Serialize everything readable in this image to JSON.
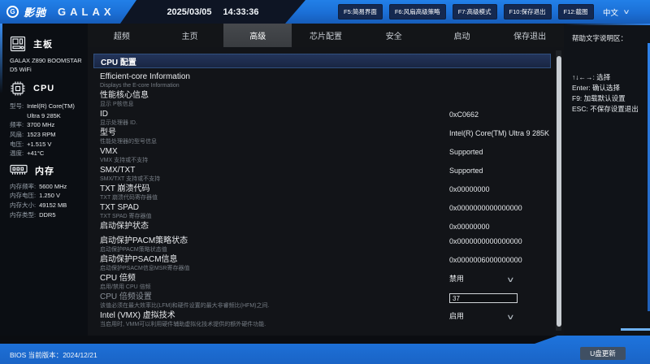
{
  "top_bar": {
    "brand_cn": "影驰",
    "brand_en": "GALAX",
    "logo_glyph": "G",
    "date": "2025/03/05",
    "time": "14:33:36",
    "fkeys": [
      "F5:简易界面",
      "F6:风扇高级策略",
      "F7:高级模式",
      "F10:保存退出",
      "F12:截图"
    ],
    "language": "中文"
  },
  "tabs": [
    {
      "id": "overclock",
      "label": "超频",
      "active": false
    },
    {
      "id": "home",
      "label": "主页",
      "active": false
    },
    {
      "id": "advanced",
      "label": "高级",
      "active": true
    },
    {
      "id": "chipset",
      "label": "芯片配置",
      "active": false
    },
    {
      "id": "security",
      "label": "安全",
      "active": false
    },
    {
      "id": "boot",
      "label": "启动",
      "active": false
    },
    {
      "id": "save-exit",
      "label": "保存退出",
      "active": false
    }
  ],
  "sidebar": {
    "board": {
      "icon": "motherboard-icon",
      "label": "主板",
      "name": "GALAX Z890 BOOMSTAR D5 WiFi"
    },
    "cpu": {
      "icon": "cpu-icon",
      "label": "CPU",
      "rows": [
        {
          "k": "型号:",
          "v": "Intel(R) Core(TM) Ultra 9 285K"
        },
        {
          "k": "频率:",
          "v": "3700 MHz"
        },
        {
          "k": "风扇:",
          "v": "1523 RPM"
        },
        {
          "k": "电压:",
          "v": "+1.515 V"
        },
        {
          "k": "温度:",
          "v": "+41°C"
        }
      ]
    },
    "memory": {
      "icon": "ram-icon",
      "label": "内存",
      "rows": [
        {
          "k": "内存频率:",
          "v": "5600 MHz"
        },
        {
          "k": "内存电压:",
          "v": "1.250 V"
        },
        {
          "k": "内存大小:",
          "v": "49152 MB"
        },
        {
          "k": "内存类型:",
          "v": "DDR5"
        }
      ]
    }
  },
  "content": {
    "section_title": "CPU 配置",
    "rows": [
      {
        "title": "Efficient-core Information",
        "desc": "Displays the E-core Information",
        "value": "",
        "control": "none"
      },
      {
        "title": "性能核心信息",
        "desc": "显示 P核信息",
        "value": "",
        "control": "none"
      },
      {
        "title": "ID",
        "desc": "显示处理器 ID.",
        "value": "0xC0662",
        "control": "text"
      },
      {
        "title": "型号",
        "desc": "性能处理器的型号信息",
        "value": "Intel(R) Core(TM) Ultra 9 285K",
        "control": "text"
      },
      {
        "title": "VMX",
        "desc": "VMX 支持或不支持",
        "value": "Supported",
        "control": "text"
      },
      {
        "title": "SMX/TXT",
        "desc": "SMX/TXT 支持或不支持",
        "value": "Supported",
        "control": "text"
      },
      {
        "title": "TXT 崩溃代码",
        "desc": "TXT 崩溃代码寄存器值",
        "value": "0x00000000",
        "control": "text"
      },
      {
        "title": "TXT SPAD",
        "desc": "TXT SPAD 寄存器值",
        "value": "0x0000000000000000",
        "control": "text"
      },
      {
        "title": "启动保护状态",
        "desc": "",
        "value": "0x00000000",
        "control": "text",
        "short": true
      },
      {
        "title": "启动保护PACM策略状态",
        "desc": "启动保护PACM策略状态值",
        "value": "0x0000000000000000",
        "control": "text"
      },
      {
        "title": "启动保护PSACM信息",
        "desc": "启动保护PSACM信息MSR寄存器值",
        "value": "0x0000006000000000",
        "control": "text"
      },
      {
        "title": "CPU 倍频",
        "desc": "启用/禁用 CPU 倍频",
        "value": "禁用",
        "control": "select"
      },
      {
        "title": "CPU 倍频设置",
        "desc": "该值必须在最大效率比(LFM)和硬件设置的最大非睿频比(HFM)之间.",
        "value": "37",
        "control": "input",
        "disabled": true
      },
      {
        "title": "Intel (VMX) 虚拟技术",
        "desc": "当启用时, VMM可以利用硬件辅助虚拟化技术提供的额外硬件功能.",
        "value": "启用",
        "control": "select"
      }
    ]
  },
  "help": {
    "title": "帮助文字说明区：",
    "lines": [
      "↑↓←→:  选择",
      "Enter:  确认选择",
      "F9:  加载默认设置",
      "ESC:  不保存设置退出"
    ]
  },
  "bottom": {
    "version_label": "BIOS 当前版本：",
    "version": "2024/12/21",
    "update_button": "U盘更新"
  },
  "colors": {
    "accent_blue": "#1b6fd6",
    "section_header_navy": "#1c2a45",
    "active_tab_gray": "#3e4347",
    "content_bg": "#121418",
    "scroll_thumb": "#c9ced3"
  }
}
